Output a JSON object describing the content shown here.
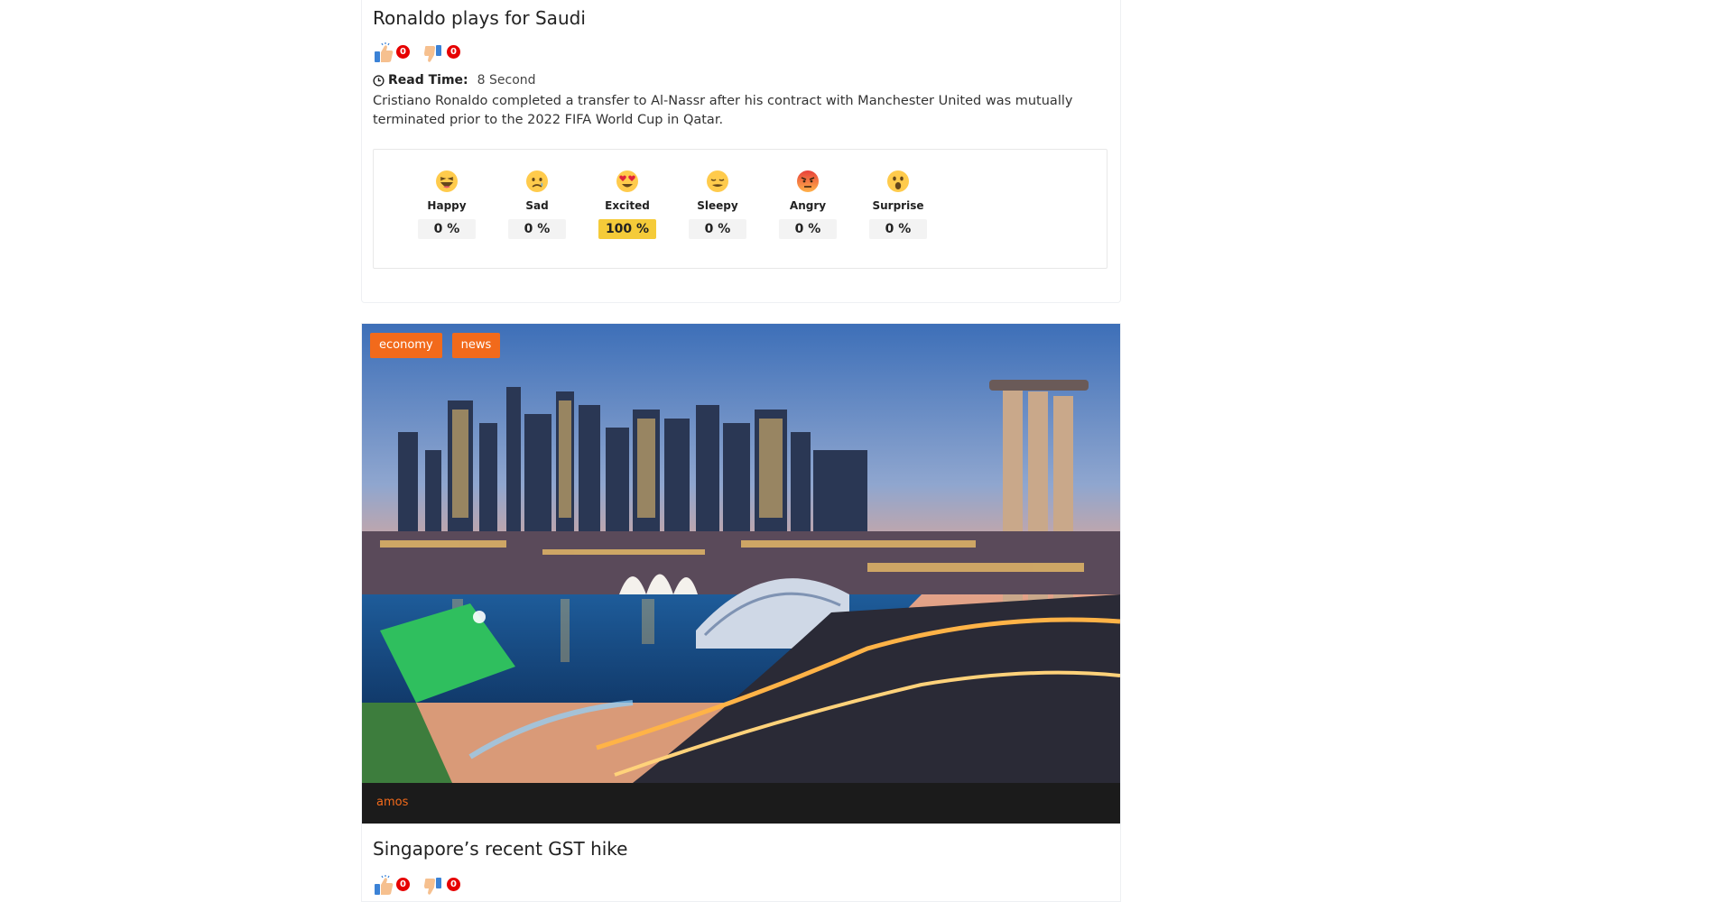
{
  "post1": {
    "title": "Ronaldo plays for Saudi",
    "likes": "0",
    "dislikes": "0",
    "read_time_label": "Read Time:",
    "read_time_value": "8 Second",
    "description": "Cristiano Ronaldo completed a transfer to Al-Nassr after his contract with Manchester United was mutually terminated prior to the 2022 FIFA World Cup in Qatar.",
    "reactions": [
      {
        "label": "Happy",
        "percent": "0 %",
        "value": 0,
        "icon": "laughing-emoji-icon"
      },
      {
        "label": "Sad",
        "percent": "0 %",
        "value": 0,
        "icon": "sad-emoji-icon"
      },
      {
        "label": "Excited",
        "percent": "100 %",
        "value": 100,
        "icon": "heart-eyes-emoji-icon"
      },
      {
        "label": "Sleepy",
        "percent": "0 %",
        "value": 0,
        "icon": "sleepy-emoji-icon"
      },
      {
        "label": "Angry",
        "percent": "0 %",
        "value": 0,
        "icon": "angry-emoji-icon"
      },
      {
        "label": "Surprise",
        "percent": "0 %",
        "value": 0,
        "icon": "surprised-emoji-icon"
      }
    ]
  },
  "post2": {
    "tags": [
      "economy",
      "news"
    ],
    "author": "amos",
    "title": "Singapore’s recent GST hike",
    "likes": "0",
    "dislikes": "0",
    "image_icon": "city-skyline-photo"
  },
  "colors": {
    "accent": "#f26a1b",
    "badge": "#e60000",
    "active_reaction": "#f5cb39",
    "author_bar": "#1b1b1b"
  }
}
